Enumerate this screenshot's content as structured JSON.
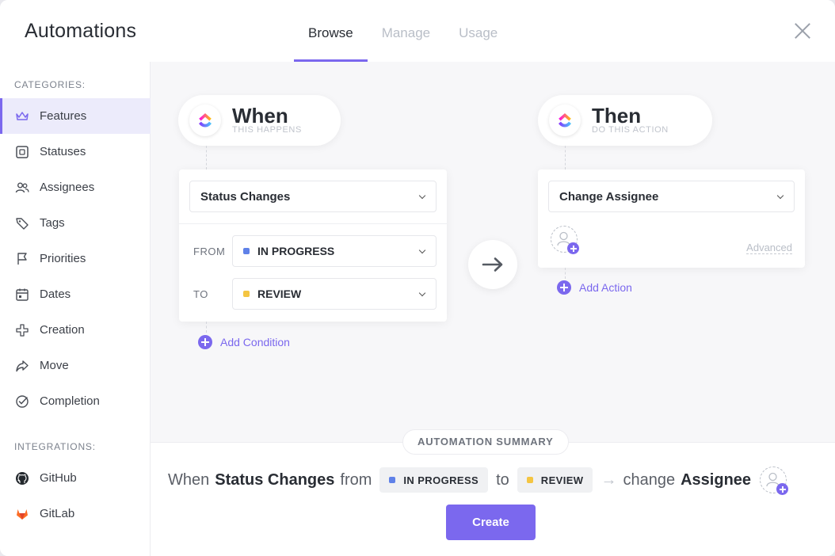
{
  "header": {
    "title": "Automations",
    "tabs": [
      {
        "label": "Browse",
        "active": true
      },
      {
        "label": "Manage",
        "active": false
      },
      {
        "label": "Usage",
        "active": false
      }
    ]
  },
  "sidebar": {
    "categories_label": "CATEGORIES:",
    "categories": [
      {
        "label": "Features",
        "icon": "crown-icon",
        "active": true
      },
      {
        "label": "Statuses",
        "icon": "square-icon"
      },
      {
        "label": "Assignees",
        "icon": "people-icon"
      },
      {
        "label": "Tags",
        "icon": "tag-icon"
      },
      {
        "label": "Priorities",
        "icon": "flag-icon"
      },
      {
        "label": "Dates",
        "icon": "calendar-icon"
      },
      {
        "label": "Creation",
        "icon": "plus-cross-icon"
      },
      {
        "label": "Move",
        "icon": "share-arrow-icon"
      },
      {
        "label": "Completion",
        "icon": "check-circle-icon"
      }
    ],
    "integrations_label": "INTEGRATIONS:",
    "integrations": [
      {
        "label": "GitHub",
        "icon": "github-icon"
      },
      {
        "label": "GitLab",
        "icon": "gitlab-icon"
      }
    ]
  },
  "trigger": {
    "title": "When",
    "subtitle": "THIS HAPPENS",
    "select": "Status Changes",
    "from_label": "FROM",
    "from_value": "IN PROGRESS",
    "to_label": "TO",
    "to_value": "REVIEW",
    "add_condition": "Add Condition"
  },
  "action": {
    "title": "Then",
    "subtitle": "DO THIS ACTION",
    "select": "Change Assignee",
    "advanced": "Advanced",
    "add_action": "Add Action"
  },
  "summary": {
    "label": "AUTOMATION SUMMARY",
    "when": "When",
    "trigger": "Status Changes",
    "from": "from",
    "from_status": "IN PROGRESS",
    "to": "to",
    "to_status": "REVIEW",
    "arrow": "→",
    "change": "change",
    "target": "Assignee",
    "create_button": "Create"
  },
  "colors": {
    "accent": "#7b68ee",
    "in_progress": "#5f81e8",
    "review": "#f4c542"
  }
}
